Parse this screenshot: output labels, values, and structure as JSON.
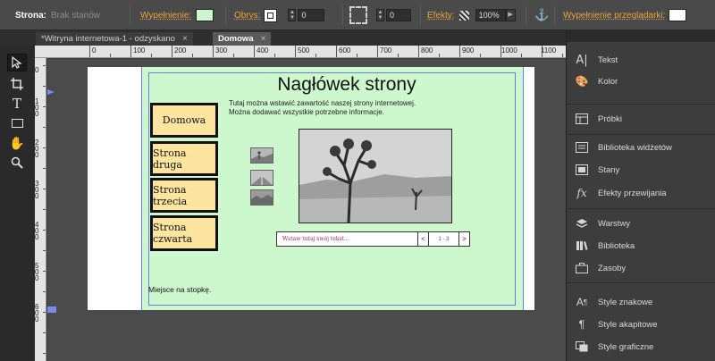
{
  "colors": {
    "accent_orange": "#e8a33a",
    "page_fill": "#cdf7cd",
    "nav_button_fill": "#fde5a0",
    "guide": "#6a7ae8"
  },
  "control_bar": {
    "page_label": "Strona:",
    "page_value": "Brak stanów",
    "fill_label": "Wypełnienie:",
    "stroke_label": "Obrys:",
    "stroke_width": "0",
    "corner_radius": "0",
    "effects_label": "Efekty:",
    "opacity": "100%",
    "browser_fill_label": "Wypełnienie przeglądarki:"
  },
  "tabs": [
    {
      "label": "*Witryna internetowa-1 - odzyskano",
      "active": false
    },
    {
      "label": "Domowa",
      "active": true
    }
  ],
  "ruler": {
    "h": [
      "0",
      "100",
      "200",
      "300",
      "400",
      "500",
      "600",
      "700",
      "800",
      "900",
      "1000",
      "1100"
    ],
    "v": [
      "0",
      "1 0 0",
      "2 0 0",
      "3 0 0",
      "4 0 0",
      "5 0 0",
      "6 0 0"
    ]
  },
  "tools": [
    "selection-tool-icon",
    "crop-tool-icon",
    "text-tool-icon",
    "rectangle-tool-icon",
    "hand-tool-icon",
    "zoom-tool-icon"
  ],
  "page": {
    "heading": "Nagłówek strony",
    "intro_line1": "Tutaj można wstawić zawartość naszej strony internetowej.",
    "intro_line2": "Można dodawać wszystkie potrzebne informacje.",
    "nav": [
      "Domowa",
      "Strona druga",
      "Strona trzecia",
      "Strona czwarta"
    ],
    "slideshow_caption": "Wstaw tutaj swój tekst...",
    "slideshow_prev": "<",
    "slideshow_counter": "1 - 3",
    "slideshow_next": ">",
    "footer": "Miejsce na stopkę."
  },
  "panel": {
    "group1": [
      {
        "icon": "text-icon",
        "label": "Tekst"
      },
      {
        "icon": "color-palette-icon",
        "label": "Kolor"
      }
    ],
    "group2": [
      {
        "icon": "samples-icon",
        "label": "Próbki"
      }
    ],
    "group3": [
      {
        "icon": "widget-library-icon",
        "label": "Biblioteka widżetów"
      },
      {
        "icon": "states-icon",
        "label": "Stany"
      },
      {
        "icon": "transition-effects-icon",
        "label": "Efekty przewijania"
      }
    ],
    "group4": [
      {
        "icon": "layers-icon",
        "label": "Warstwy"
      },
      {
        "icon": "library-icon",
        "label": "Biblioteka"
      },
      {
        "icon": "assets-icon",
        "label": "Zasoby"
      }
    ],
    "group5": [
      {
        "icon": "character-styles-icon",
        "label": "Style znakowe"
      },
      {
        "icon": "paragraph-styles-icon",
        "label": "Style akapitowe"
      },
      {
        "icon": "graphic-styles-icon",
        "label": "Style graficzne"
      }
    ]
  }
}
